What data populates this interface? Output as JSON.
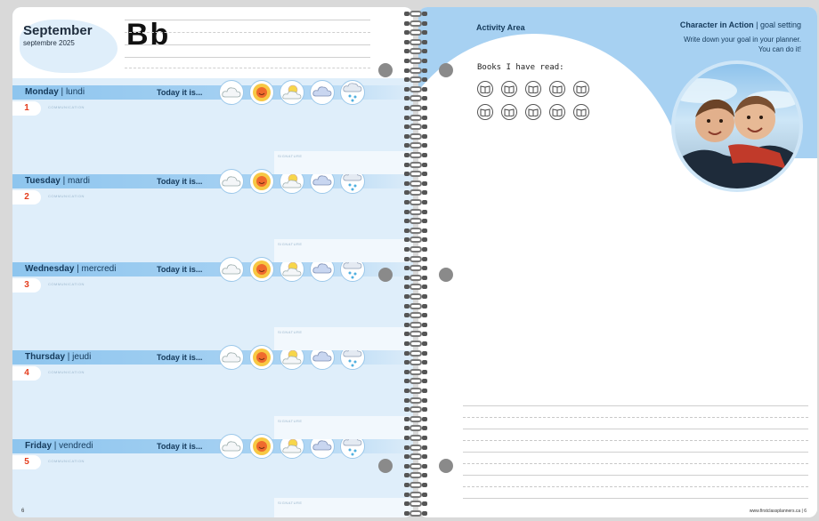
{
  "left_page": {
    "month": "September",
    "month_fr": "septembre 2025",
    "letters": "Bb",
    "page_number": "6",
    "today_label": "Today it is...",
    "communication_label": "COMMUNICATION",
    "signature_label": "SIGNATURE",
    "days": [
      {
        "name": "Monday",
        "fr": "lundi",
        "num": "1"
      },
      {
        "name": "Tuesday",
        "fr": "mardi",
        "num": "2"
      },
      {
        "name": "Wednesday",
        "fr": "mercredi",
        "num": "3"
      },
      {
        "name": "Thursday",
        "fr": "jeudi",
        "num": "4"
      },
      {
        "name": "Friday",
        "fr": "vendredi",
        "num": "5"
      }
    ],
    "weather_icons": [
      "cloud-icon",
      "sun-icon",
      "sun-cloud-icon",
      "rain-cloud-icon",
      "snow-cloud-icon"
    ]
  },
  "right_page": {
    "activity_title": "Activity Area",
    "character_title": "Character in Action",
    "character_topic": "goal setting",
    "character_text": "Write down your goal in your planner. You can do it!",
    "books_label": "Books I have read:",
    "book_count": 10,
    "footer": "www.firstclassplanners.ca | 6"
  },
  "colors": {
    "band": "#8ec5ee",
    "page_bg": "#dfeefa",
    "accent_red": "#e43c1c",
    "navy": "#153a5b"
  }
}
